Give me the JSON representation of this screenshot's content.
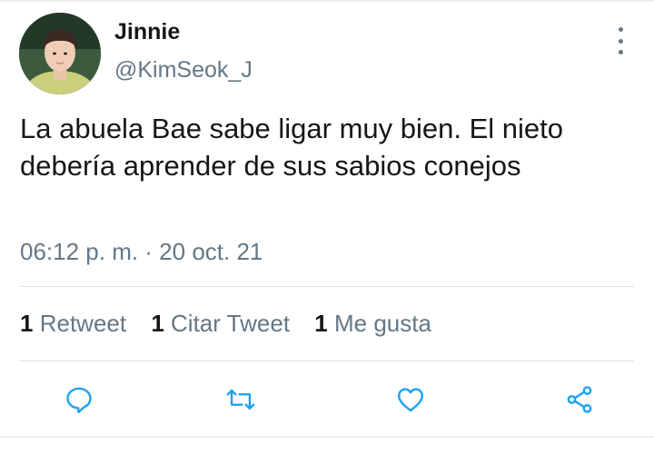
{
  "tweet": {
    "author_name": "Jinnie",
    "author_handle": "@KimSeok_J",
    "text": "La abuela Bae sabe ligar muy bien. El nieto debería aprender de sus sabios conejos",
    "timestamp": "06:12 p. m. · 20 oct. 21"
  },
  "stats": [
    {
      "count": "1",
      "label": "Retweet"
    },
    {
      "count": "1",
      "label": "Citar Tweet"
    },
    {
      "count": "1",
      "label": "Me gusta"
    }
  ],
  "actions": [
    {
      "name": "reply-icon"
    },
    {
      "name": "retweet-icon"
    },
    {
      "name": "like-icon"
    },
    {
      "name": "share-icon"
    }
  ],
  "colors": {
    "primary_text": "#14171a",
    "secondary_text": "#657786",
    "icon": "#1da1f2",
    "divider": "#d9e1e8"
  }
}
